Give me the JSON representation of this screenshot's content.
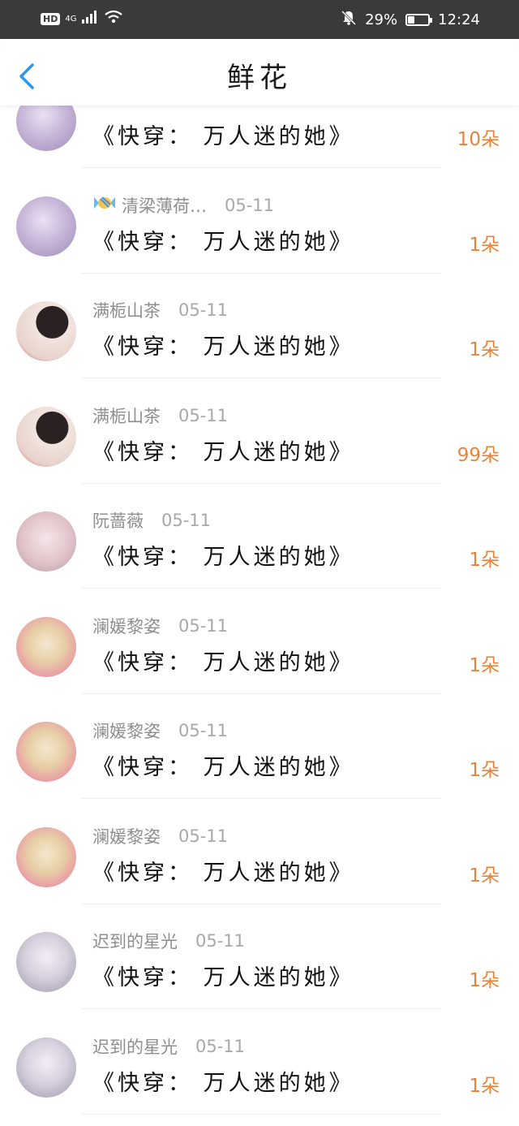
{
  "status": {
    "net": "4G",
    "battery": "29%",
    "time": "12:24",
    "battery_level": 0.29
  },
  "nav": {
    "title": "鲜花"
  },
  "rows": [
    {
      "user": "",
      "date": "",
      "book": "《快穿： 万人迷的她》",
      "count": "10朵",
      "avatar": "purple"
    },
    {
      "user": "清梁薄荷…",
      "date": "05-11",
      "book": "《快穿： 万人迷的她》",
      "count": "1朵",
      "avatar": "purple",
      "badge": "candy"
    },
    {
      "user": "满栀山茶",
      "date": "05-11",
      "book": "《快穿： 万人迷的她》",
      "count": "1朵",
      "avatar": "girl-red"
    },
    {
      "user": "满栀山茶",
      "date": "05-11",
      "book": "《快穿： 万人迷的她》",
      "count": "99朵",
      "avatar": "girl-red"
    },
    {
      "user": "阮蔷薇",
      "date": "05-11",
      "book": "《快穿： 万人迷的她》",
      "count": "1朵",
      "avatar": "pale-pink"
    },
    {
      "user": "澜媛黎姿",
      "date": "05-11",
      "book": "《快穿： 万人迷的她》",
      "count": "1朵",
      "avatar": "blonde"
    },
    {
      "user": "澜媛黎姿",
      "date": "05-11",
      "book": "《快穿： 万人迷的她》",
      "count": "1朵",
      "avatar": "blonde"
    },
    {
      "user": "澜媛黎姿",
      "date": "05-11",
      "book": "《快穿： 万人迷的她》",
      "count": "1朵",
      "avatar": "blonde"
    },
    {
      "user": "迟到的星光",
      "date": "05-11",
      "book": "《快穿： 万人迷的她》",
      "count": "1朵",
      "avatar": "silver"
    },
    {
      "user": "迟到的星光",
      "date": "05-11",
      "book": "《快穿： 万人迷的她》",
      "count": "1朵",
      "avatar": "silver"
    }
  ]
}
